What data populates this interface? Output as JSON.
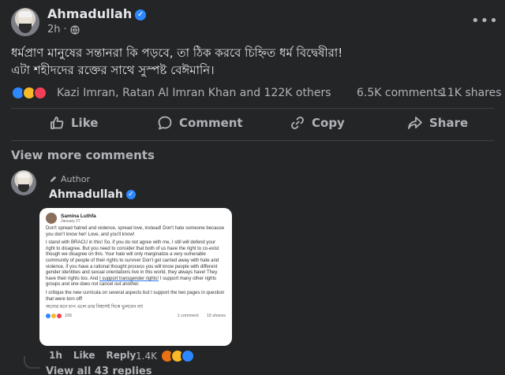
{
  "post": {
    "author": "Ahmadullah",
    "time": "2h",
    "text_line1": "ধর্মপ্রাণ মানুষের সন্তানরা কি পড়বে, তা ঠিক করবে চিহ্নিত ধর্ম বিদ্বেষীরা!",
    "text_line2": "এটা শহীদদের রক্তের সাথে সুস্পষ্ট বেঈমানি।",
    "reactions_text": "Kazi Imran, Ratan Al Imran Khan and 122K others",
    "comments_count": "6.5K comments",
    "shares_count": "11K shares"
  },
  "actions": {
    "like": "Like",
    "comment": "Comment",
    "copy": "Copy",
    "share": "Share"
  },
  "view_more": "View more comments",
  "comment": {
    "badge": "Author",
    "author": "Ahmadullah",
    "time": "1h",
    "like": "Like",
    "reply": "Reply",
    "reactions_count": "1.4K",
    "view_replies": "View all 43 replies"
  },
  "embedded": {
    "author": "Samina Luthfa",
    "date": "January 27 · ",
    "p1": "Don't spread hatred and violence, spread love, instead! Don't hate someone because you don't know her! Love, and you'll know!",
    "p2a": "I stand with BRACU in this! So, if you do not agree with me, I still will defend your right to disagree. But you need to consider that both of us have the right to co-exist though we disagree on this. Your hate will only marginalize a very vulnerable community of people of their rights to survive! Don't get carried away with hate and violence, if you have a rational thought process you will know people with different gender identities and sexual orientations live in this world, they always have! They have their rights too. And ",
    "p2b": "I support transgender rights!",
    "p2c": " I support many other rights groups and one does not cancel out another.",
    "p3": "I critique the new curricula on several aspects but I support the two pages in question that were torn off!",
    "p4": "অন্যের মনে চাপ এলে তার বিশ্বাসই দিকে ভুলবেন না!",
    "react_count": "165",
    "comments": "1 comment",
    "shares": "10 shares"
  },
  "colors": {
    "background": "#242526",
    "text": "#e4e6eb",
    "muted": "#b0b3b8",
    "accent": "#2d88ff",
    "divider": "#3e4042"
  },
  "icons": [
    "more-icon",
    "globe-icon",
    "like-icon",
    "comment-icon",
    "copy-icon",
    "share-icon",
    "pencil-icon",
    "verified-icon"
  ]
}
